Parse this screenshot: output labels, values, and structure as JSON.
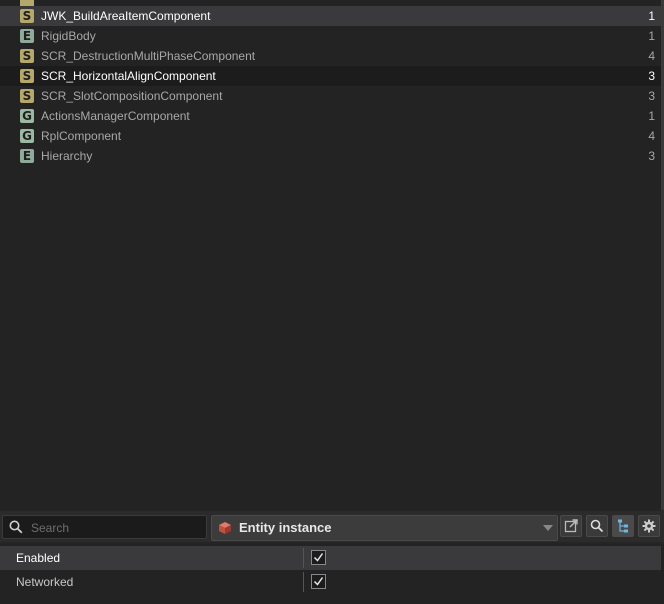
{
  "component_list": {
    "items": [
      {
        "badge": "S",
        "label": "JWK_BuildAreaItemComponent",
        "count": "1",
        "state": "selected"
      },
      {
        "badge": "E",
        "label": "RigidBody",
        "count": "1",
        "state": ""
      },
      {
        "badge": "S",
        "label": "SCR_DestructionMultiPhaseComponent",
        "count": "4",
        "state": ""
      },
      {
        "badge": "S",
        "label": "SCR_HorizontalAlignComponent",
        "count": "3",
        "state": "hover"
      },
      {
        "badge": "S",
        "label": "SCR_SlotCompositionComponent",
        "count": "3",
        "state": ""
      },
      {
        "badge": "G",
        "label": "ActionsManagerComponent",
        "count": "1",
        "state": ""
      },
      {
        "badge": "G",
        "label": "RplComponent",
        "count": "4",
        "state": ""
      },
      {
        "badge": "E",
        "label": "Hierarchy",
        "count": "3",
        "state": ""
      }
    ]
  },
  "toolbar": {
    "search_placeholder": "Search",
    "search_value": "",
    "type_select_value": "Entity instance",
    "icons": [
      "search-icon",
      "cube-icon",
      "chevron-down-icon",
      "external-link-icon",
      "magnify-icon",
      "hierarchy-icon",
      "gear-icon"
    ]
  },
  "properties": {
    "rows": [
      {
        "label": "Enabled",
        "checked": true
      },
      {
        "label": "Networked",
        "checked": true
      }
    ]
  },
  "colors": {
    "badge_S": "#b4a86a",
    "badge_E": "#8fa99a",
    "badge_G": "#9bb8a0",
    "selection": "#3a3a3c",
    "background": "#232323"
  }
}
